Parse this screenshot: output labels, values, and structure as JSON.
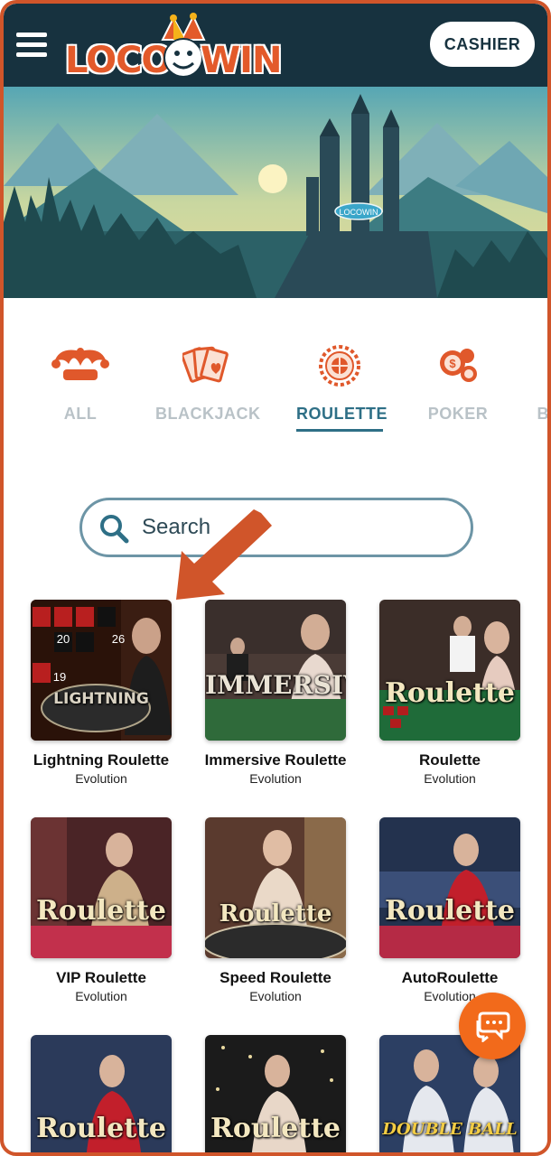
{
  "header": {
    "logo_text_left": "LOCO",
    "logo_text_right": "WIN",
    "cashier_label": "CASHIER"
  },
  "banner": {
    "castle_sign": "LOCOWIN"
  },
  "categories": [
    {
      "label": "ALL",
      "icon": "jester-hat-icon",
      "active": false
    },
    {
      "label": "BLACKJACK",
      "icon": "playing-cards-icon",
      "active": false
    },
    {
      "label": "ROULETTE",
      "icon": "roulette-wheel-icon",
      "active": true
    },
    {
      "label": "POKER",
      "icon": "poker-chips-icon",
      "active": false
    },
    {
      "label": "BA",
      "icon": "",
      "active": false
    }
  ],
  "search": {
    "placeholder": "Search"
  },
  "games": [
    {
      "name": "Lightning Roulette",
      "provider": "Evolution",
      "thumb_text": "LIGHTNING"
    },
    {
      "name": "Immersive Roulette",
      "provider": "Evolution",
      "thumb_text": "IMMERSIVE"
    },
    {
      "name": "Roulette",
      "provider": "Evolution",
      "thumb_text": "Roulette"
    },
    {
      "name": "VIP Roulette",
      "provider": "Evolution",
      "thumb_text": "Roulette"
    },
    {
      "name": "Speed Roulette",
      "provider": "Evolution",
      "thumb_text": "Roulette"
    },
    {
      "name": "AutoRoulette",
      "provider": "Evolution",
      "thumb_text": "Roulette"
    },
    {
      "name": "",
      "provider": "",
      "thumb_text": "Roulette"
    },
    {
      "name": "",
      "provider": "",
      "thumb_text": "Roulette"
    },
    {
      "name": "",
      "provider": "",
      "thumb_text": "DOUBLE BALL"
    }
  ],
  "colors": {
    "accent": "#d0552a",
    "header_bg": "#17323f",
    "active_tab": "#2e6f86",
    "chat_button": "#f26a1b"
  }
}
